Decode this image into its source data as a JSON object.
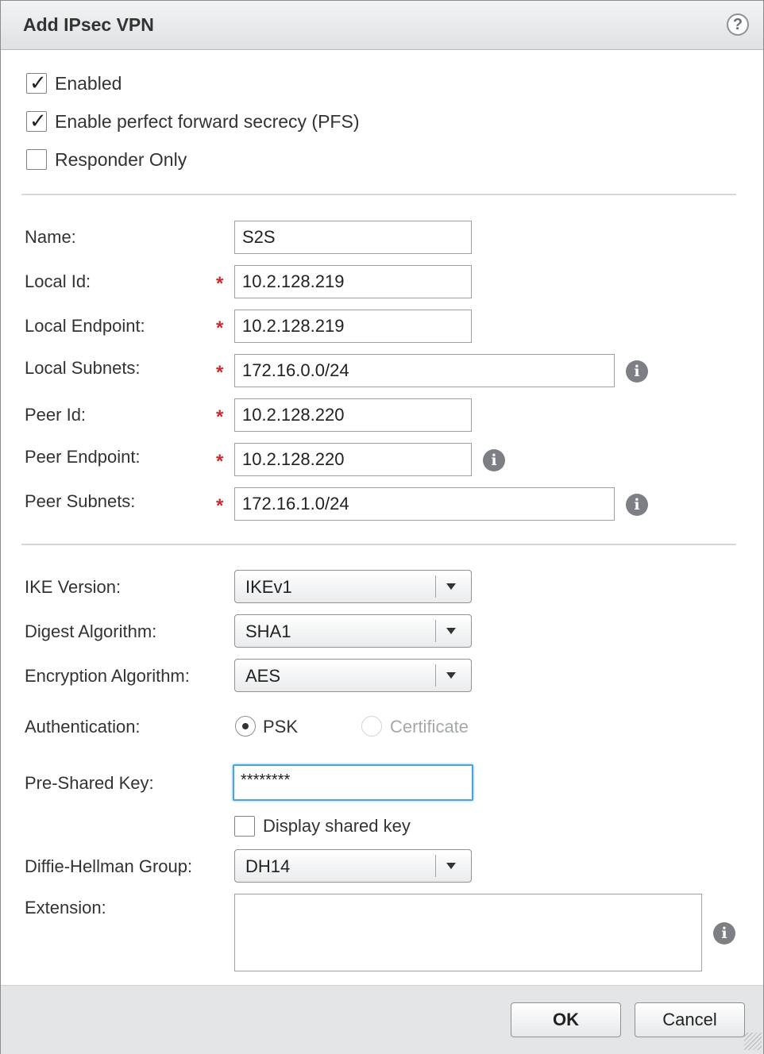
{
  "dialog": {
    "title": "Add IPsec VPN",
    "help_icon": "help-icon"
  },
  "options": {
    "enabled": {
      "label": "Enabled",
      "checked": true
    },
    "pfs": {
      "label": "Enable perfect forward secrecy (PFS)",
      "checked": true
    },
    "responder_only": {
      "label": "Responder Only",
      "checked": false
    }
  },
  "fields": {
    "name": {
      "label": "Name:",
      "value": "S2S"
    },
    "local_id": {
      "label": "Local Id:",
      "value": "10.2.128.219"
    },
    "local_endpoint": {
      "label": "Local Endpoint:",
      "value": "10.2.128.219"
    },
    "local_subnets": {
      "label": "Local Subnets:",
      "value": "172.16.0.0/24"
    },
    "peer_id": {
      "label": "Peer Id:",
      "value": "10.2.128.220"
    },
    "peer_endpoint": {
      "label": "Peer Endpoint:",
      "value": "10.2.128.220"
    },
    "peer_subnets": {
      "label": "Peer Subnets:",
      "value": "172.16.1.0/24"
    }
  },
  "required_mark": "*",
  "ike": {
    "version": {
      "label": "IKE Version:",
      "value": "IKEv1"
    },
    "digest": {
      "label": "Digest Algorithm:",
      "value": "SHA1"
    },
    "encryption": {
      "label": "Encryption Algorithm:",
      "value": "AES"
    },
    "authentication": {
      "label": "Authentication:",
      "options": [
        "PSK",
        "Certificate"
      ],
      "selected": "PSK"
    },
    "psk": {
      "label": "Pre-Shared Key:",
      "value": "********"
    },
    "display_key": {
      "label": "Display shared key",
      "checked": false
    },
    "dh_group": {
      "label": "Diffie-Hellman Group:",
      "value": "DH14"
    },
    "extension": {
      "label": "Extension:",
      "value": ""
    }
  },
  "buttons": {
    "ok": "OK",
    "cancel": "Cancel"
  },
  "colors": {
    "required": "#d0282a",
    "focus": "#4aa3df",
    "info": "#7c8084"
  }
}
